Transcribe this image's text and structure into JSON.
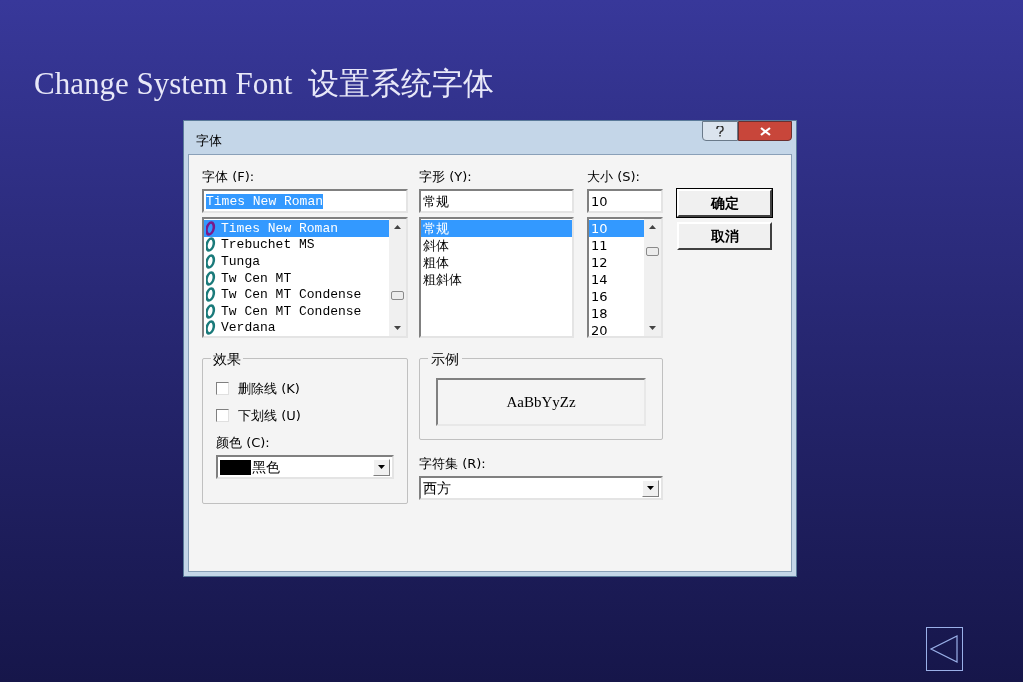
{
  "slide_title": "Change System Font  设置系统字体",
  "dialog": {
    "title": "字体",
    "font": {
      "label": "字体 (F):",
      "value": "Times New Roman",
      "items": [
        {
          "name": "Times New Roman",
          "selected": true
        },
        {
          "name": "Trebuchet MS",
          "selected": false
        },
        {
          "name": "Tunga",
          "selected": false
        },
        {
          "name": "Tw Cen MT",
          "selected": false
        },
        {
          "name": "Tw Cen MT Condense",
          "selected": false
        },
        {
          "name": "Tw Cen MT Condense",
          "selected": false
        },
        {
          "name": "Verdana",
          "selected": false
        }
      ]
    },
    "style": {
      "label": "字形 (Y):",
      "value": "常规",
      "items": [
        {
          "name": "常规",
          "selected": true
        },
        {
          "name": "斜体",
          "selected": false
        },
        {
          "name": "粗体",
          "selected": false
        },
        {
          "name": "粗斜体",
          "selected": false
        }
      ]
    },
    "size": {
      "label": "大小 (S):",
      "value": "10",
      "items": [
        {
          "name": "10",
          "selected": true
        },
        {
          "name": "11",
          "selected": false
        },
        {
          "name": "12",
          "selected": false
        },
        {
          "name": "14",
          "selected": false
        },
        {
          "name": "16",
          "selected": false
        },
        {
          "name": "18",
          "selected": false
        },
        {
          "name": "20",
          "selected": false
        }
      ]
    },
    "buttons": [
      {
        "label": "确定",
        "default": true
      },
      {
        "label": "取消",
        "default": false
      }
    ],
    "effects": {
      "title": "效果",
      "options": [
        {
          "label": "删除线 (K)",
          "checked": false
        },
        {
          "label": "下划线 (U)",
          "checked": false
        }
      ],
      "color_label": "颜色 (C):",
      "color_value": "黑色",
      "color": "#000000"
    },
    "sample": {
      "title": "示例",
      "text": "AaBbYyZz"
    },
    "charset": {
      "label": "字符集 (R):",
      "value": "西方"
    }
  }
}
